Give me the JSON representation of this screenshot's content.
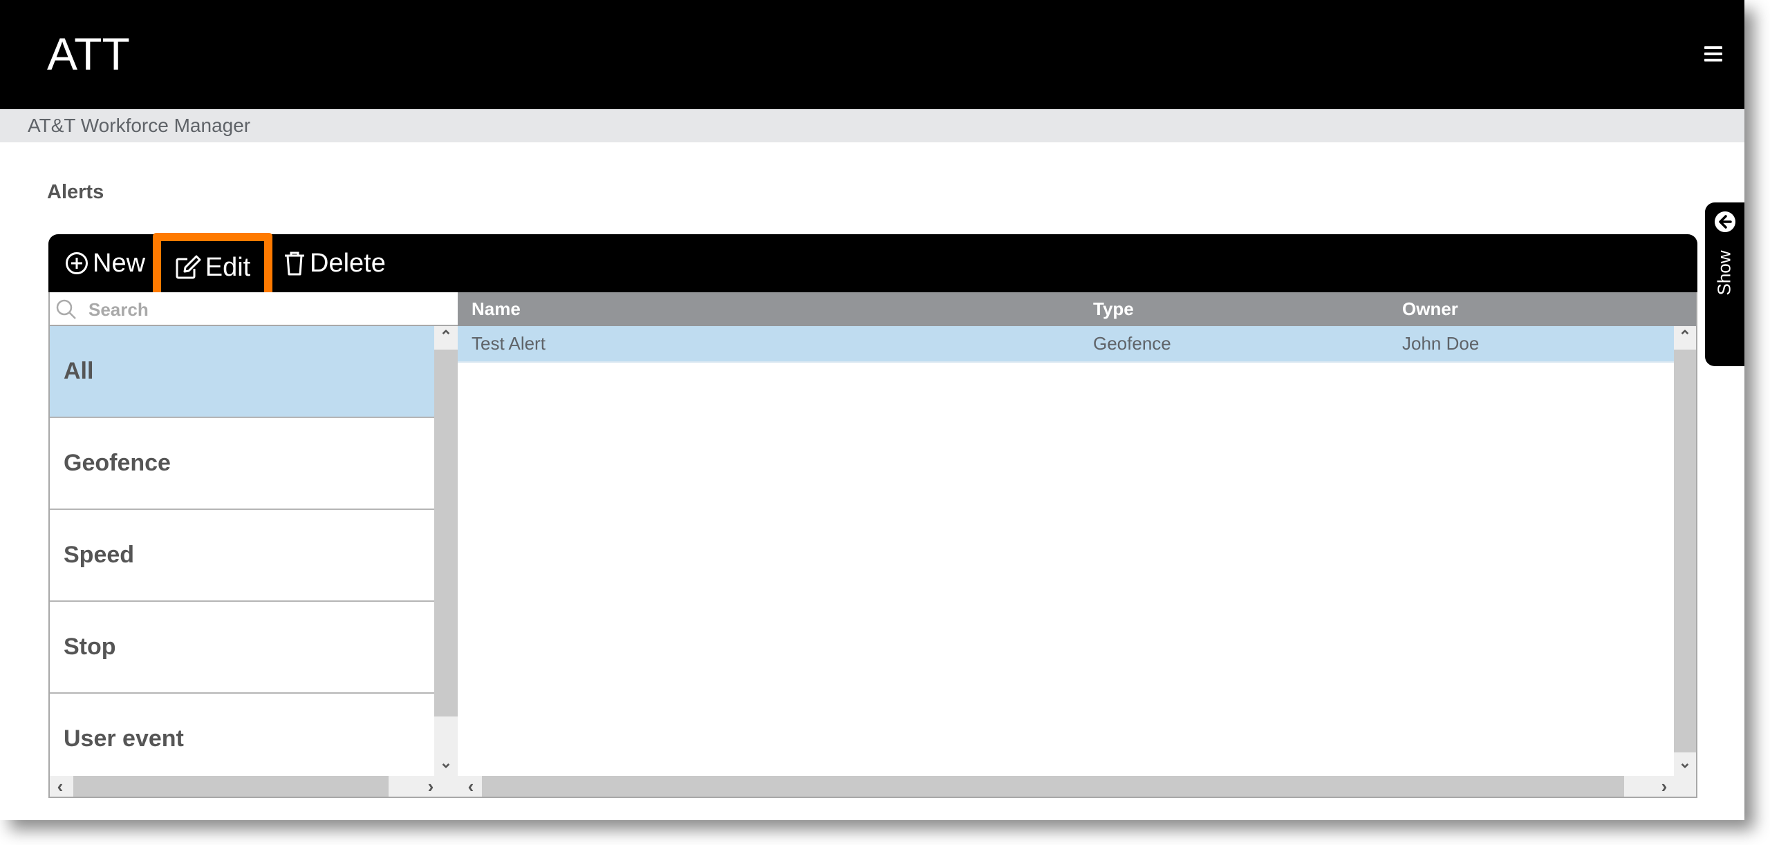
{
  "header": {
    "app_title": "ATT",
    "menu_icon": "hamburger-icon",
    "subtitle": "AT&T Workforce Manager"
  },
  "page": {
    "title": "Alerts"
  },
  "toolbar": {
    "new_label": "New",
    "edit_label": "Edit",
    "delete_label": "Delete",
    "highlight_color": "#ff7a00"
  },
  "search": {
    "placeholder": "Search",
    "value": ""
  },
  "categories": {
    "selected": "All",
    "items": [
      {
        "label": "All"
      },
      {
        "label": "Geofence"
      },
      {
        "label": "Speed"
      },
      {
        "label": "Stop"
      },
      {
        "label": "User event"
      }
    ]
  },
  "table": {
    "columns": [
      "Name",
      "Type",
      "Owner"
    ],
    "rows": [
      {
        "name": "Test Alert",
        "type": "Geofence",
        "owner": "John Doe",
        "selected": true
      }
    ]
  },
  "side_tab": {
    "label": "Show",
    "icon": "arrow-left-circle-icon"
  },
  "colors": {
    "selected_bg": "#bfdcf0",
    "header_gray": "#939598",
    "text_gray": "#555555"
  }
}
